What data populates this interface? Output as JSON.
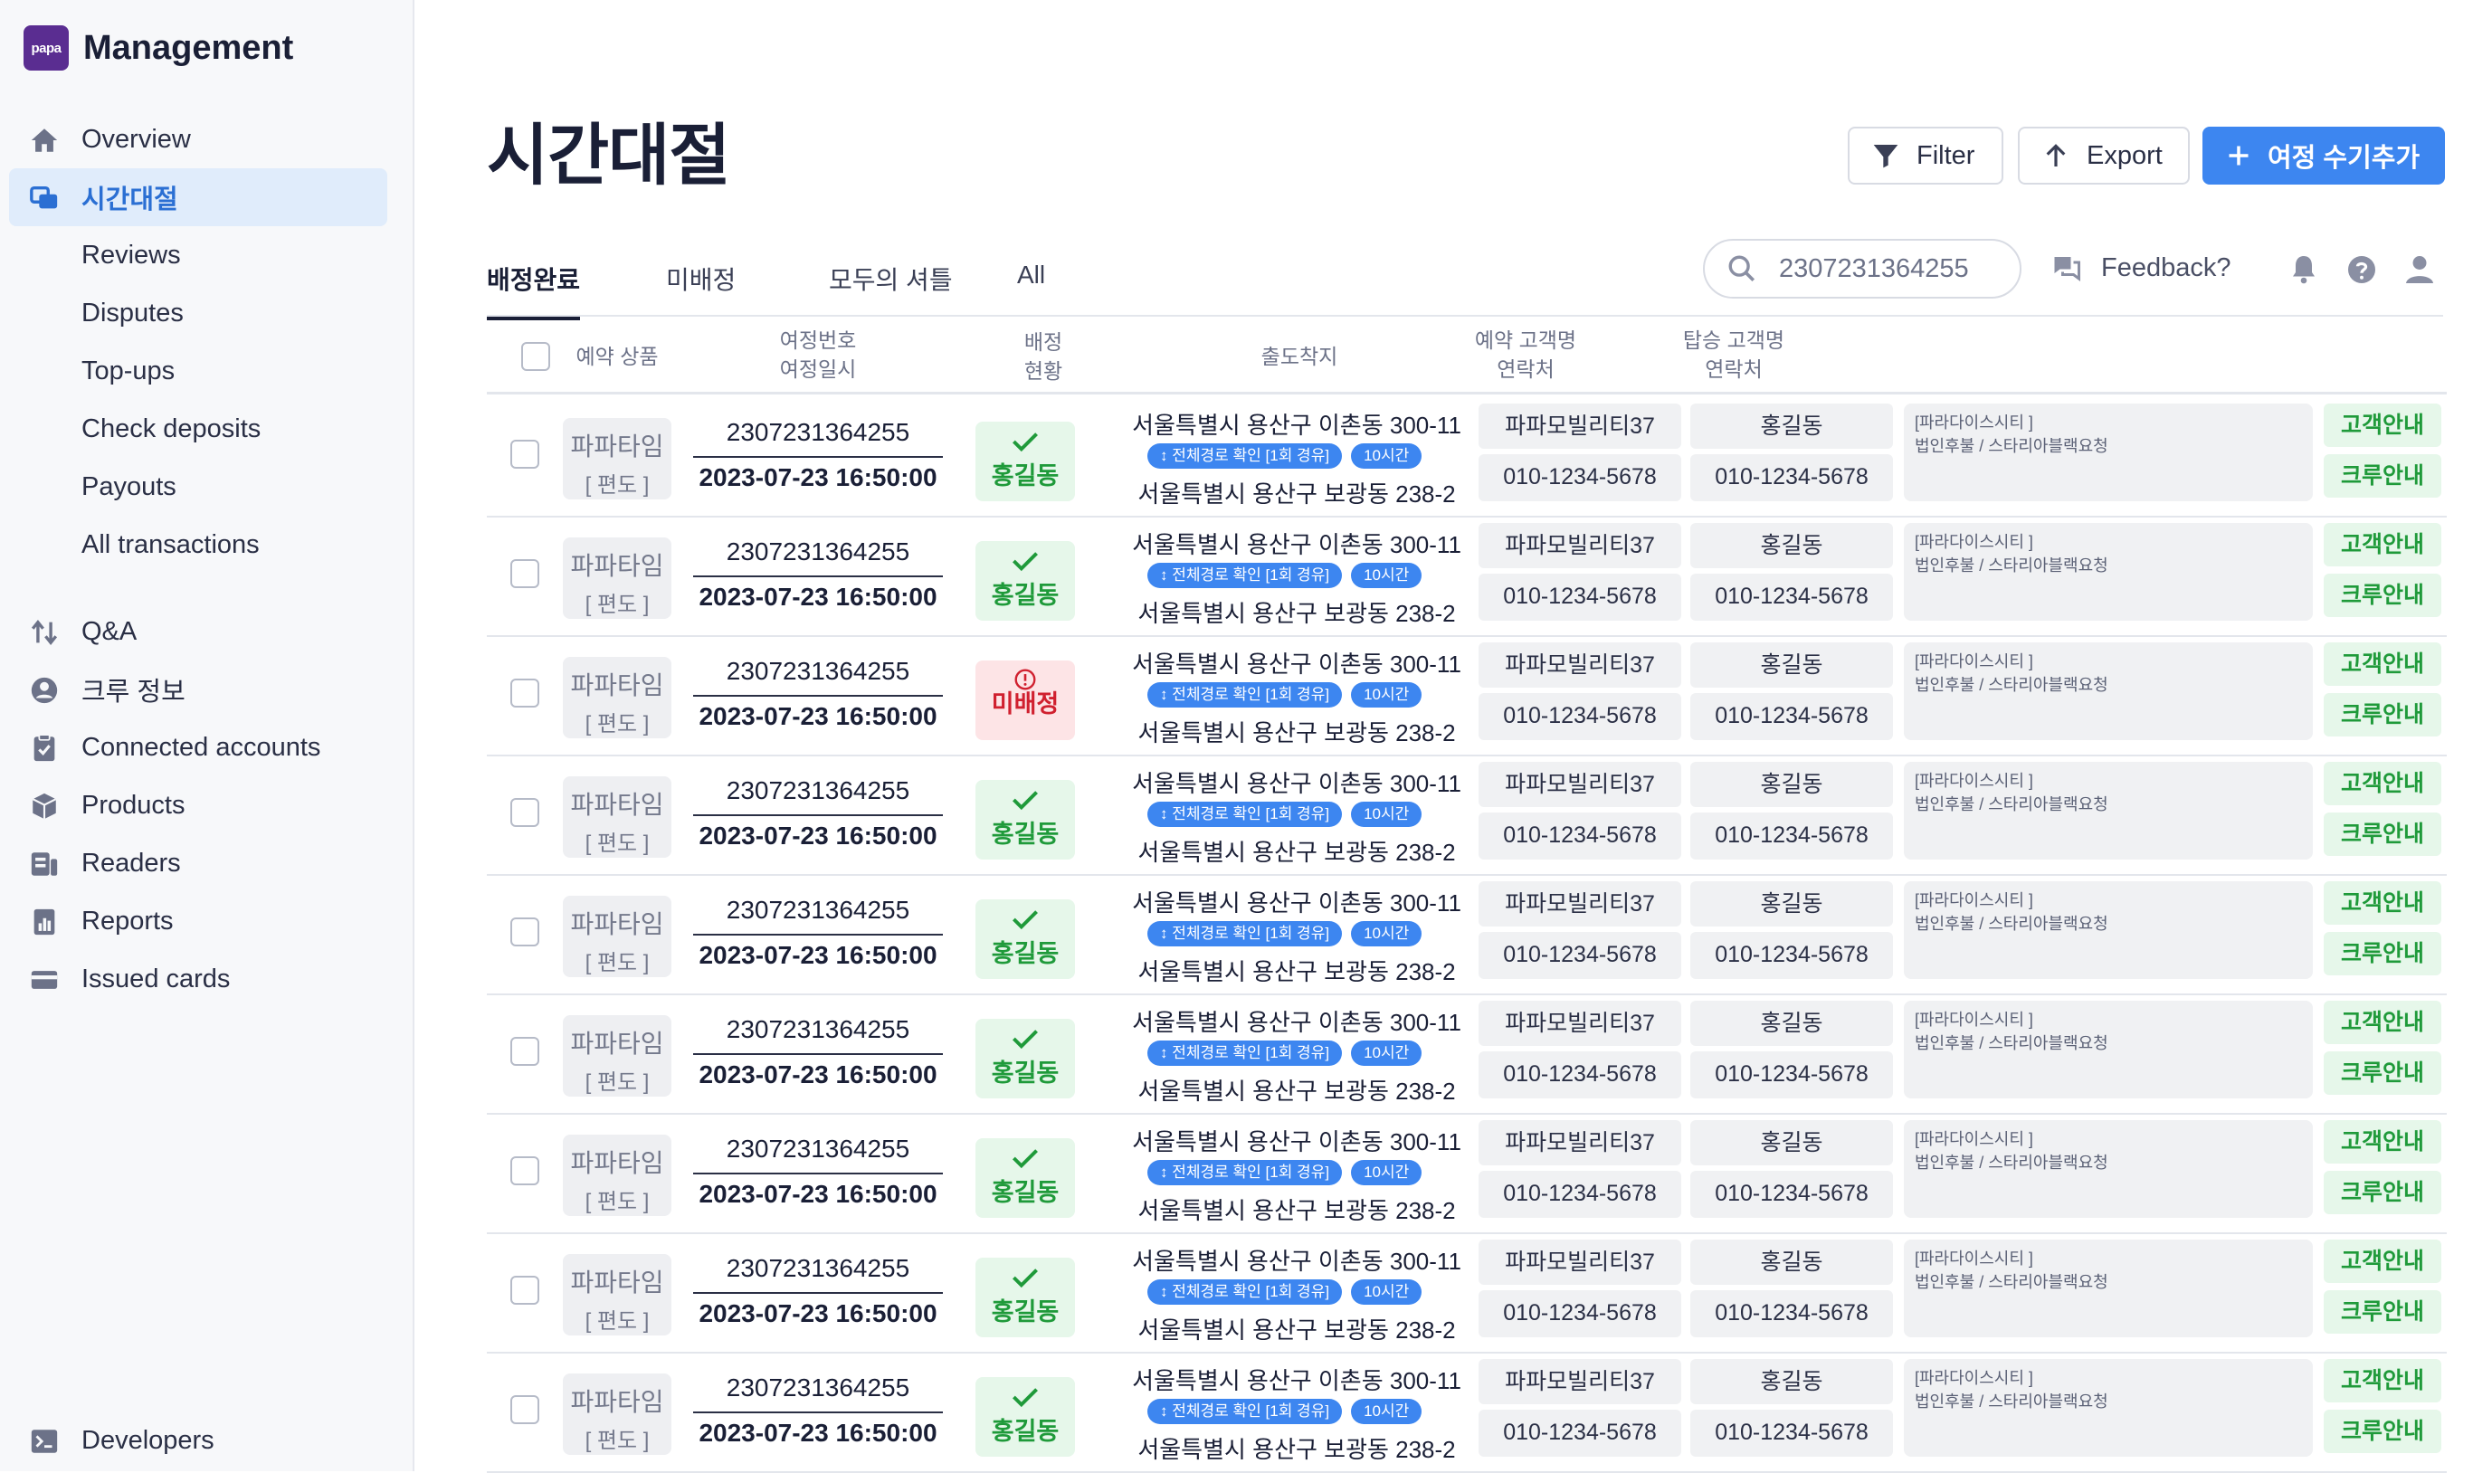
{
  "brand": {
    "logo_text": "papa",
    "name": "Management"
  },
  "sidebar": {
    "items": [
      {
        "label": "Overview",
        "icon": "home-icon"
      },
      {
        "label": "시간대절",
        "icon": "stack-icon",
        "active": true
      },
      {
        "label": "Reviews"
      },
      {
        "label": "Disputes"
      },
      {
        "label": "Top-ups"
      },
      {
        "label": "Check deposits"
      },
      {
        "label": "Payouts"
      },
      {
        "label": "All transactions"
      },
      {
        "label": "Q&A",
        "icon": "arrows-updown-icon"
      },
      {
        "label": "크루 정보",
        "icon": "user-circle-icon"
      },
      {
        "label": "Connected accounts",
        "icon": "clipboard-check-icon"
      },
      {
        "label": "Products",
        "icon": "box-icon"
      },
      {
        "label": "Readers",
        "icon": "reader-icon"
      },
      {
        "label": "Reports",
        "icon": "report-icon"
      },
      {
        "label": "Issued cards",
        "icon": "card-icon"
      }
    ],
    "bottom": {
      "label": "Developers",
      "icon": "terminal-icon"
    }
  },
  "header": {
    "title": "시간대절",
    "filter_label": "Filter",
    "export_label": "Export",
    "add_label": "여정 수기추가"
  },
  "tabs": [
    {
      "label": "배정완료",
      "active": true
    },
    {
      "label": "미배정"
    },
    {
      "label": "모두의 셔틀"
    },
    {
      "label": "All"
    }
  ],
  "search": {
    "value": "2307231364255"
  },
  "feedback_label": "Feedback?",
  "table": {
    "headers": {
      "product": "예약 상품",
      "trip_no": "여정번호",
      "trip_date": "여정일시",
      "assign_1": "배정",
      "assign_2": "현황",
      "route": "출도착지",
      "booker_1": "예약 고객명",
      "booker_2": "연락처",
      "rider_1": "탑승 고객명",
      "rider_2": "연락처"
    },
    "rows": [
      {
        "product": "파파타임",
        "product_sub": "[ 편도 ]",
        "trip_no": "2307231364255",
        "trip_date": "2023-07-23 16:50:00",
        "status": "홍길동",
        "status_type": "ok",
        "origin": "서울특별시 용산구 이촌동 300-11",
        "route_badge": "전체경로 확인 [1회 경유]",
        "hours_badge": "10시간",
        "dest": "서울특별시 용산구 보광동 238-2",
        "booker": "파파모빌리티37",
        "booker_phone": "010-1234-5678",
        "rider": "홍길동",
        "rider_phone": "010-1234-5678",
        "note_1": "[파라다이스시티 ]",
        "note_2": "법인후불 / 스타리아블랙요청",
        "guide_customer": "고객안내",
        "guide_crew": "크루안내"
      },
      {
        "product": "파파타임",
        "product_sub": "[ 편도 ]",
        "trip_no": "2307231364255",
        "trip_date": "2023-07-23 16:50:00",
        "status": "홍길동",
        "status_type": "ok",
        "origin": "서울특별시 용산구 이촌동 300-11",
        "route_badge": "전체경로 확인 [1회 경유]",
        "hours_badge": "10시간",
        "dest": "서울특별시 용산구 보광동 238-2",
        "booker": "파파모빌리티37",
        "booker_phone": "010-1234-5678",
        "rider": "홍길동",
        "rider_phone": "010-1234-5678",
        "note_1": "[파라다이스시티 ]",
        "note_2": "법인후불 / 스타리아블랙요청",
        "guide_customer": "고객안내",
        "guide_crew": "크루안내"
      },
      {
        "product": "파파타임",
        "product_sub": "[ 편도 ]",
        "trip_no": "2307231364255",
        "trip_date": "2023-07-23 16:50:00",
        "status": "미배정",
        "status_type": "ng",
        "origin": "서울특별시 용산구 이촌동 300-11",
        "route_badge": "전체경로 확인 [1회 경유]",
        "hours_badge": "10시간",
        "dest": "서울특별시 용산구 보광동 238-2",
        "booker": "파파모빌리티37",
        "booker_phone": "010-1234-5678",
        "rider": "홍길동",
        "rider_phone": "010-1234-5678",
        "note_1": "[파라다이스시티 ]",
        "note_2": "법인후불 / 스타리아블랙요청",
        "guide_customer": "고객안내",
        "guide_crew": "크루안내"
      },
      {
        "product": "파파타임",
        "product_sub": "[ 편도 ]",
        "trip_no": "2307231364255",
        "trip_date": "2023-07-23 16:50:00",
        "status": "홍길동",
        "status_type": "ok",
        "origin": "서울특별시 용산구 이촌동 300-11",
        "route_badge": "전체경로 확인 [1회 경유]",
        "hours_badge": "10시간",
        "dest": "서울특별시 용산구 보광동 238-2",
        "booker": "파파모빌리티37",
        "booker_phone": "010-1234-5678",
        "rider": "홍길동",
        "rider_phone": "010-1234-5678",
        "note_1": "[파라다이스시티 ]",
        "note_2": "법인후불 / 스타리아블랙요청",
        "guide_customer": "고객안내",
        "guide_crew": "크루안내"
      },
      {
        "product": "파파타임",
        "product_sub": "[ 편도 ]",
        "trip_no": "2307231364255",
        "trip_date": "2023-07-23 16:50:00",
        "status": "홍길동",
        "status_type": "ok",
        "origin": "서울특별시 용산구 이촌동 300-11",
        "route_badge": "전체경로 확인 [1회 경유]",
        "hours_badge": "10시간",
        "dest": "서울특별시 용산구 보광동 238-2",
        "booker": "파파모빌리티37",
        "booker_phone": "010-1234-5678",
        "rider": "홍길동",
        "rider_phone": "010-1234-5678",
        "note_1": "[파라다이스시티 ]",
        "note_2": "법인후불 / 스타리아블랙요청",
        "guide_customer": "고객안내",
        "guide_crew": "크루안내"
      },
      {
        "product": "파파타임",
        "product_sub": "[ 편도 ]",
        "trip_no": "2307231364255",
        "trip_date": "2023-07-23 16:50:00",
        "status": "홍길동",
        "status_type": "ok",
        "origin": "서울특별시 용산구 이촌동 300-11",
        "route_badge": "전체경로 확인 [1회 경유]",
        "hours_badge": "10시간",
        "dest": "서울특별시 용산구 보광동 238-2",
        "booker": "파파모빌리티37",
        "booker_phone": "010-1234-5678",
        "rider": "홍길동",
        "rider_phone": "010-1234-5678",
        "note_1": "[파라다이스시티 ]",
        "note_2": "법인후불 / 스타리아블랙요청",
        "guide_customer": "고객안내",
        "guide_crew": "크루안내"
      },
      {
        "product": "파파타임",
        "product_sub": "[ 편도 ]",
        "trip_no": "2307231364255",
        "trip_date": "2023-07-23 16:50:00",
        "status": "홍길동",
        "status_type": "ok",
        "origin": "서울특별시 용산구 이촌동 300-11",
        "route_badge": "전체경로 확인 [1회 경유]",
        "hours_badge": "10시간",
        "dest": "서울특별시 용산구 보광동 238-2",
        "booker": "파파모빌리티37",
        "booker_phone": "010-1234-5678",
        "rider": "홍길동",
        "rider_phone": "010-1234-5678",
        "note_1": "[파라다이스시티 ]",
        "note_2": "법인후불 / 스타리아블랙요청",
        "guide_customer": "고객안내",
        "guide_crew": "크루안내"
      },
      {
        "product": "파파타임",
        "product_sub": "[ 편도 ]",
        "trip_no": "2307231364255",
        "trip_date": "2023-07-23 16:50:00",
        "status": "홍길동",
        "status_type": "ok",
        "origin": "서울특별시 용산구 이촌동 300-11",
        "route_badge": "전체경로 확인 [1회 경유]",
        "hours_badge": "10시간",
        "dest": "서울특별시 용산구 보광동 238-2",
        "booker": "파파모빌리티37",
        "booker_phone": "010-1234-5678",
        "rider": "홍길동",
        "rider_phone": "010-1234-5678",
        "note_1": "[파라다이스시티 ]",
        "note_2": "법인후불 / 스타리아블랙요청",
        "guide_customer": "고객안내",
        "guide_crew": "크루안내"
      },
      {
        "product": "파파타임",
        "product_sub": "[ 편도 ]",
        "trip_no": "2307231364255",
        "trip_date": "2023-07-23 16:50:00",
        "status": "홍길동",
        "status_type": "ok",
        "origin": "서울특별시 용산구 이촌동 300-11",
        "route_badge": "전체경로 확인 [1회 경유]",
        "hours_badge": "10시간",
        "dest": "서울특별시 용산구 보광동 238-2",
        "booker": "파파모빌리티37",
        "booker_phone": "010-1234-5678",
        "rider": "홍길동",
        "rider_phone": "010-1234-5678",
        "note_1": "[파라다이스시티 ]",
        "note_2": "법인후불 / 스타리아블랙요청",
        "guide_customer": "고객안내",
        "guide_crew": "크루안내"
      }
    ]
  },
  "colors": {
    "accent": "#3d86f0",
    "success": "#1f9a3a",
    "danger": "#d0202f",
    "brand": "#5a2d91"
  }
}
